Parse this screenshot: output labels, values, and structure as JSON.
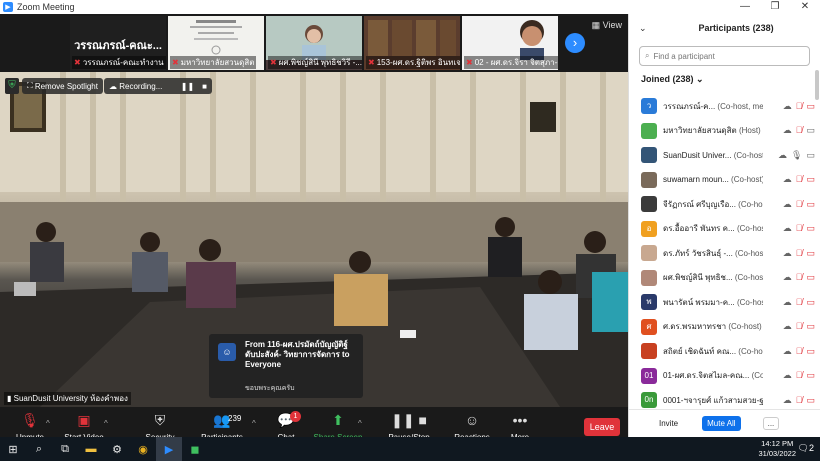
{
  "window": {
    "title": "Zoom Meeting",
    "controls": [
      "—",
      "❐",
      "✕"
    ]
  },
  "gallery": {
    "view_label": "View",
    "tiles": [
      {
        "display_name": "วรรณภรณ์-คณะ...",
        "label": "วรรณภรณ์-คณะทำงาน"
      },
      {
        "label": "มหาวิทยาลัยสวนดุสิต"
      },
      {
        "label": "ผศ.พิชญ์สินี พุทธิชวิรี -..."
      },
      {
        "label": "153-ผศ.ดร.ฐิติพร อินทเจ..."
      },
      {
        "label": "02 - ผศ.ดร.จิรา จิตสุภา-คณ..."
      }
    ]
  },
  "spotlight": {
    "remove_label": "Remove Spotlight",
    "recording_label": "Recording..."
  },
  "video": {
    "speaker_label": "SuanDusit University ห้องคำพอง"
  },
  "chat_toast": {
    "from": "From 116-ผศ.ปรมัตถ์บัญญัติฐ์ ดับปะสังค์- วิทยาการจัดการ to Everyone",
    "message": "ขอบพระคุณครับ"
  },
  "toolbar": {
    "unmute": "Unmute",
    "start_video": "Start Video",
    "security": "Security",
    "participants": "Participants",
    "participants_count": "239",
    "chat": "Chat",
    "chat_badge": "1",
    "share_screen": "Share Screen",
    "pause_recording": "Pause/Stop Recording",
    "reactions": "Reactions",
    "more": "More",
    "leave": "Leave"
  },
  "participants_panel": {
    "title": "Participants (238)",
    "search_placeholder": "Find a participant",
    "joined_label": "Joined (238)",
    "participants": [
      {
        "avatar": "ว",
        "avatar_color": "#2a7bd8",
        "name": "วรรณภรณ์-ค...",
        "role": "(Co-host, me)",
        "mic_muted": true,
        "video_off": true
      },
      {
        "avatar": "",
        "avatar_color": "#4caf50",
        "name": "มหาวิทยาลัยสวนดุสิต",
        "role": "(Host)",
        "mic_muted": true,
        "video_off": false
      },
      {
        "avatar": "",
        "avatar_color": "#335577",
        "name": "SuanDusit Univer...",
        "role": "(Co-host)",
        "mic_muted": false,
        "video_off": false
      },
      {
        "avatar": "",
        "avatar_color": "#7a6a5a",
        "name": "suwamarn moun...",
        "role": "(Co-host)",
        "mic_muted": true,
        "video_off": true
      },
      {
        "avatar": "",
        "avatar_color": "#3b3b3b",
        "name": "จีรัฏกรณ์ ศรีบุญเรือ...",
        "role": "(Co-host)",
        "mic_muted": true,
        "video_off": true
      },
      {
        "avatar": "อ",
        "avatar_color": "#f0a020",
        "name": "ดร.อื้ออารี พันทร ค...",
        "role": "(Co-host)",
        "mic_muted": true,
        "video_off": true
      },
      {
        "avatar": "",
        "avatar_color": "#c8a890",
        "name": "ดร.ภัทร์ วัชรสินธุ์ -...",
        "role": "(Co-host)",
        "mic_muted": true,
        "video_off": true
      },
      {
        "avatar": "",
        "avatar_color": "#b08878",
        "name": "ผศ.พิชญ์สินี พุทธิช...",
        "role": "(Co-host)",
        "mic_muted": true,
        "video_off": true
      },
      {
        "avatar": "พ",
        "avatar_color": "#2a3a6a",
        "name": "พนารัตน์ พรมมา-ค...",
        "role": "(Co-host)",
        "mic_muted": true,
        "video_off": true
      },
      {
        "avatar": "ศ",
        "avatar_color": "#e05020",
        "name": "ศ.ดร.พรมหาทรชา",
        "role": "(Co-host)",
        "mic_muted": true,
        "video_off": true
      },
      {
        "avatar": "",
        "avatar_color": "#c84020",
        "name": "สถิตย์ เชิดฉันท์ คณ...",
        "role": "(Co-host)",
        "mic_muted": true,
        "video_off": true
      },
      {
        "avatar": "01",
        "avatar_color": "#8a2a9a",
        "name": "01-ผศ.ดร.จิตสไมล-คณ...",
        "role": "(Co-host)",
        "mic_muted": true,
        "video_off": true
      },
      {
        "avatar": "0n",
        "avatar_color": "#3a9a3a",
        "name": "0001-ฯจารุยศ์ แก้วสามสวย-ฐมน่า...",
        "role": "",
        "mic_muted": true,
        "video_off": true
      }
    ],
    "invite_label": "Invite",
    "mute_all_label": "Mute All",
    "more_label": "..."
  },
  "taskbar": {
    "time": "14:12 PM",
    "date": "31/03/2022",
    "notification_count": "2"
  }
}
